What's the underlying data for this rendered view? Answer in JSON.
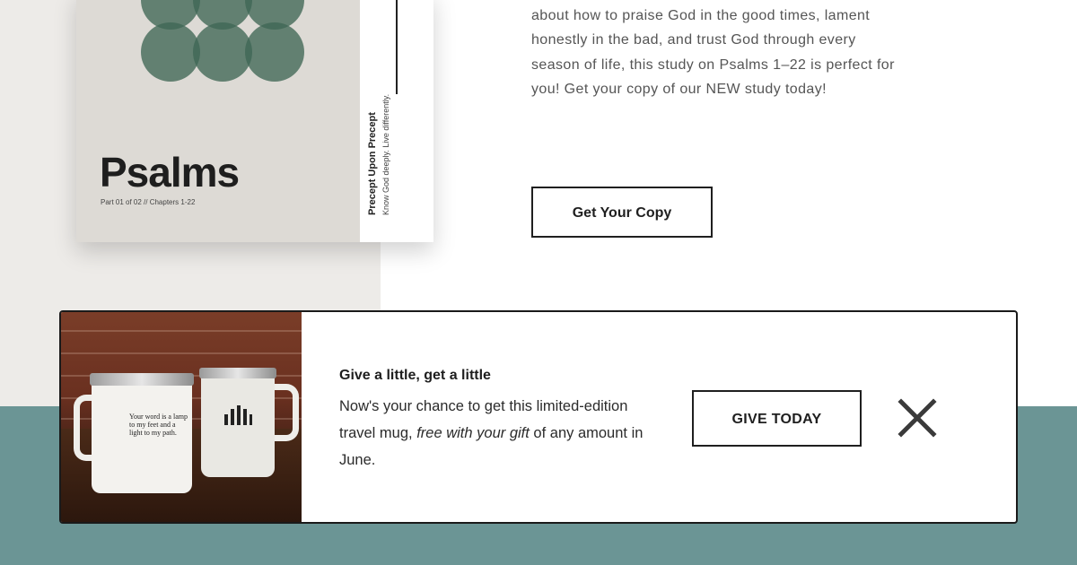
{
  "book": {
    "title": "Psalms",
    "subtitle": "Part 01 of 02  //  Chapters 1-22",
    "spine_title": "Precept Upon Precept",
    "spine_tagline": "Know God deeply. Live differently."
  },
  "intro": {
    "description": "about how to praise God in the good times, lament honestly in the bad, and trust God through every season of life, this study on Psalms 1–22 is perfect for you! Get your copy of our NEW study today!",
    "cta_label": "Get Your Copy"
  },
  "promo": {
    "heading": "Give a little, get a little",
    "body_before": "Now's your chance to get this limited-edition travel mug, ",
    "body_emphasis": "free with your gift",
    "body_after": " of any amount in June.",
    "button_label": "GIVE TODAY",
    "mug_text": "Your word is a lamp to my feet and a light to my path.",
    "close_icon": "close-icon"
  },
  "colors": {
    "teal": "#6b9595",
    "circle_green": "#3f6655",
    "cover_bg": "#dddad5",
    "left_panel": "#edebe8"
  }
}
